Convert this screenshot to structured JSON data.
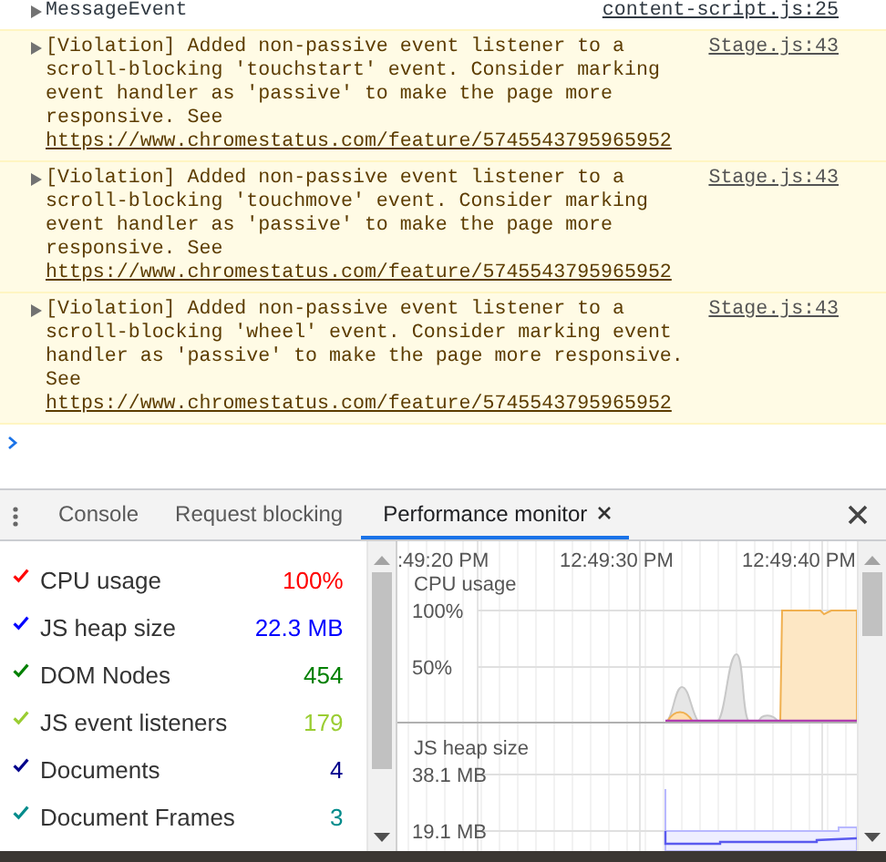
{
  "console": {
    "messages": [
      {
        "kind": "log",
        "text": "MessageEvent",
        "source": "content-script.js:25"
      },
      {
        "kind": "violation",
        "text": "[Violation] Added non-passive event listener to a scroll-blocking 'touchstart' event. Consider marking event handler as 'passive' to make the page more responsive. See ",
        "link": "https://www.chromestatus.com/feature/5745543795965952",
        "source": "Stage.js:43"
      },
      {
        "kind": "violation",
        "text": "[Violation] Added non-passive event listener to a scroll-blocking 'touchmove' event. Consider marking event handler as 'passive' to make the page more responsive. See ",
        "link": "https://www.chromestatus.com/feature/5745543795965952",
        "source": "Stage.js:43"
      },
      {
        "kind": "violation",
        "text": "[Violation] Added non-passive event listener to a scroll-blocking 'wheel' event. Consider marking event handler as 'passive' to make the page more responsive. See ",
        "link": "https://www.chromestatus.com/feature/5745543795965952",
        "source": "Stage.js:43"
      }
    ]
  },
  "drawer": {
    "tabs": [
      {
        "label": "Console",
        "selected": false,
        "closable": false
      },
      {
        "label": "Request blocking",
        "selected": false,
        "closable": false
      },
      {
        "label": "Performance monitor",
        "selected": true,
        "closable": true
      }
    ]
  },
  "metrics": [
    {
      "label": "CPU usage",
      "value": "100%",
      "color": "#ff0000",
      "checked": true
    },
    {
      "label": "JS heap size",
      "value": "22.3 MB",
      "color": "#0000ff",
      "checked": true
    },
    {
      "label": "DOM Nodes",
      "value": "454",
      "color": "#008000",
      "checked": true
    },
    {
      "label": "JS event listeners",
      "value": "179",
      "color": "#9acd32",
      "checked": true
    },
    {
      "label": "Documents",
      "value": "4",
      "color": "#00008b",
      "checked": true
    },
    {
      "label": "Document Frames",
      "value": "3",
      "color": "#008b8b",
      "checked": true
    }
  ],
  "timeline": {
    "time_labels": [
      ":49:20 PM",
      "12:49:30 PM",
      "12:49:40 PM"
    ],
    "panels": [
      {
        "kind": "cpu",
        "title": "CPU usage",
        "ticks": [
          "100%",
          "50%"
        ]
      },
      {
        "kind": "heap",
        "title": "JS heap size",
        "ticks": [
          "38.1 MB",
          "19.1 MB"
        ]
      }
    ]
  }
}
